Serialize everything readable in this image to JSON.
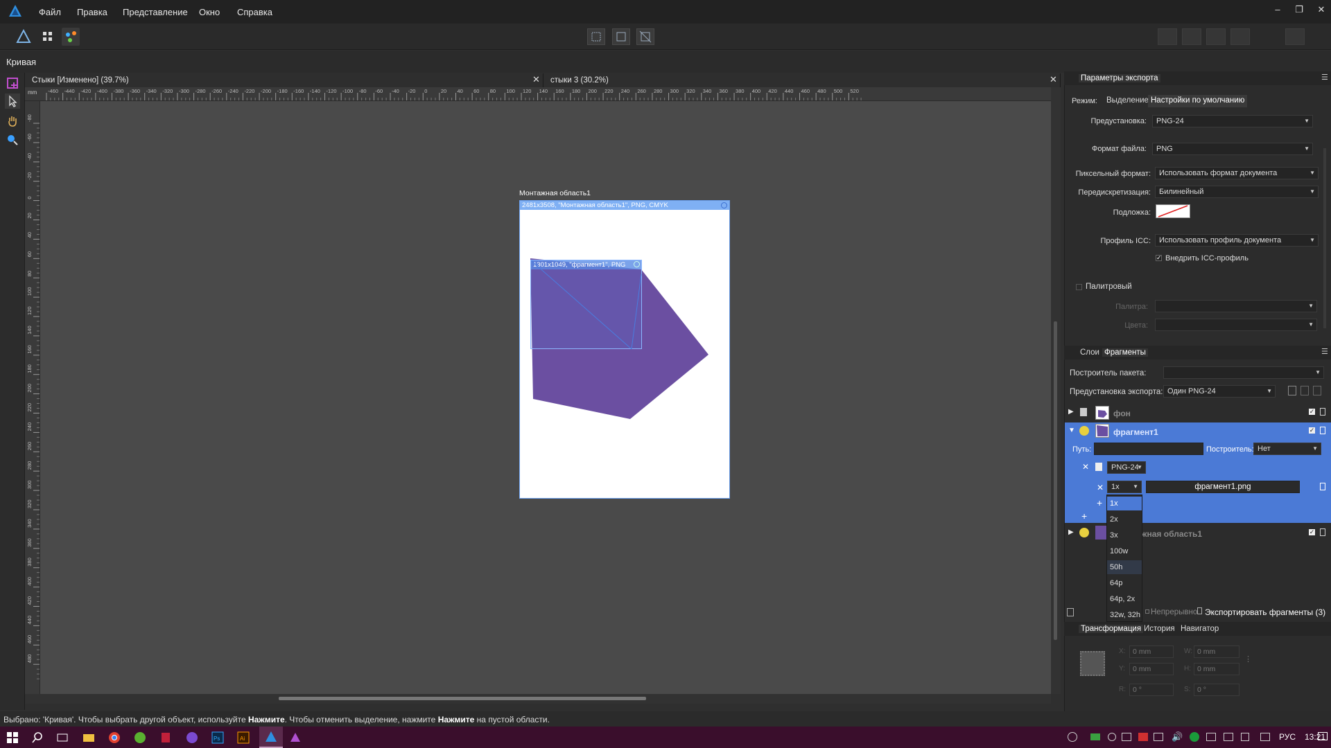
{
  "menu": [
    "Файл",
    "Правка",
    "Представление",
    "Окно",
    "Справка"
  ],
  "context_label": "Кривая",
  "doc_tabs": [
    {
      "label": "Стыки [Изменено] (39.7%)"
    },
    {
      "label": "стыки 3 (30.2%)"
    }
  ],
  "ruler": {
    "unit": "mm",
    "top_ticks": [
      "-460",
      "-440",
      "-420",
      "-400",
      "-380",
      "-360",
      "-340",
      "-320",
      "-300",
      "-280",
      "-260",
      "-240",
      "-220",
      "-200",
      "-180",
      "-160",
      "-140",
      "-120",
      "-100",
      "-80",
      "-60",
      "-40",
      "-20",
      "0",
      "20",
      "40",
      "60",
      "80",
      "100",
      "120",
      "140",
      "160",
      "180",
      "200",
      "220",
      "240",
      "260",
      "280",
      "300",
      "320",
      "340",
      "360",
      "380",
      "400",
      "420",
      "440",
      "460",
      "480",
      "500",
      "520"
    ],
    "left_ticks": [
      "-80",
      "-60",
      "-40",
      "-20",
      "0",
      "20",
      "40",
      "60",
      "80",
      "100",
      "120",
      "140",
      "160",
      "180",
      "200",
      "220",
      "240",
      "260",
      "280",
      "300",
      "320",
      "340",
      "360",
      "380",
      "400",
      "420",
      "440",
      "460",
      "480"
    ]
  },
  "artboard": {
    "title": "Монтажная область1",
    "info": "2481x3508, \"Монтажная область1\", PNG, CMYK",
    "slice_info": "1301x1049, \"фрагмент1\", PNG"
  },
  "export_panel": {
    "title": "Параметры экспорта",
    "mode_label": "Режим:",
    "mode_options": [
      "Выделение",
      "Настройки по умолчанию"
    ],
    "preset_label": "Предустановка:",
    "preset_value": "PNG-24",
    "format_label": "Формат файла:",
    "format_value": "PNG",
    "pixel_format_label": "Пиксельный формат:",
    "pixel_format_value": "Использовать формат документа",
    "resample_label": "Передискретизация:",
    "resample_value": "Билинейный",
    "matte_label": "Подложка:",
    "icc_label": "Профиль ICC:",
    "icc_value": "Использовать профиль документа",
    "embed_icc": "Внедрить ICC-профиль",
    "palette_label": "Палитровый",
    "palette_sub": "Палитра:",
    "colors_sub": "Цвета:"
  },
  "slices_panel": {
    "tabs": [
      "Слои",
      "Фрагменты"
    ],
    "builder_label": "Построитель пакета:",
    "export_preset_label": "Предустановка экспорта:",
    "export_preset_value": "Один PNG-24",
    "rows": [
      {
        "name": "фон"
      },
      {
        "name": "фрагмент1"
      },
      {
        "name": "жная область1"
      }
    ],
    "path_label": "Путь:",
    "builder2_label": "Построитель:",
    "builder2_value": "Нет",
    "format_tag": "PNG-24",
    "scale_value": "1x",
    "filename": "фрагмент1.png",
    "scale_options": [
      "1x",
      "2x",
      "3x",
      "100w",
      "50h",
      "64p",
      "64p, 2x",
      "32w, 32h"
    ],
    "continuous_label": "Непрерывно",
    "export_button": "Экспортировать фрагменты (3)"
  },
  "transform_panel": {
    "tabs": [
      "Трансформация",
      "История",
      "Навигатор"
    ],
    "x_label": "X:",
    "x_value": "0 mm",
    "y_label": "Y:",
    "y_value": "0 mm",
    "w_label": "W:",
    "w_value": "0 mm",
    "h_label": "H:",
    "h_value": "0 mm",
    "r_label": "R:",
    "r_value": "0 °",
    "s_label": "S:",
    "s_value": "0 °"
  },
  "status": {
    "prefix": "Выбрано: 'Кривая'. Чтобы выбрать другой объект, используйте ",
    "b1": "Нажмите",
    "mid": ". Чтобы отменить выделение, нажмите ",
    "b2": "Нажмите",
    "suffix": " на пустой области."
  },
  "taskbar": {
    "lang": "РУС",
    "time": "13:21"
  },
  "colors": {
    "shape_fill": "#6b4fa1",
    "selection_blue": "#4b7ad6",
    "taskbar": "#3a0e2c"
  }
}
